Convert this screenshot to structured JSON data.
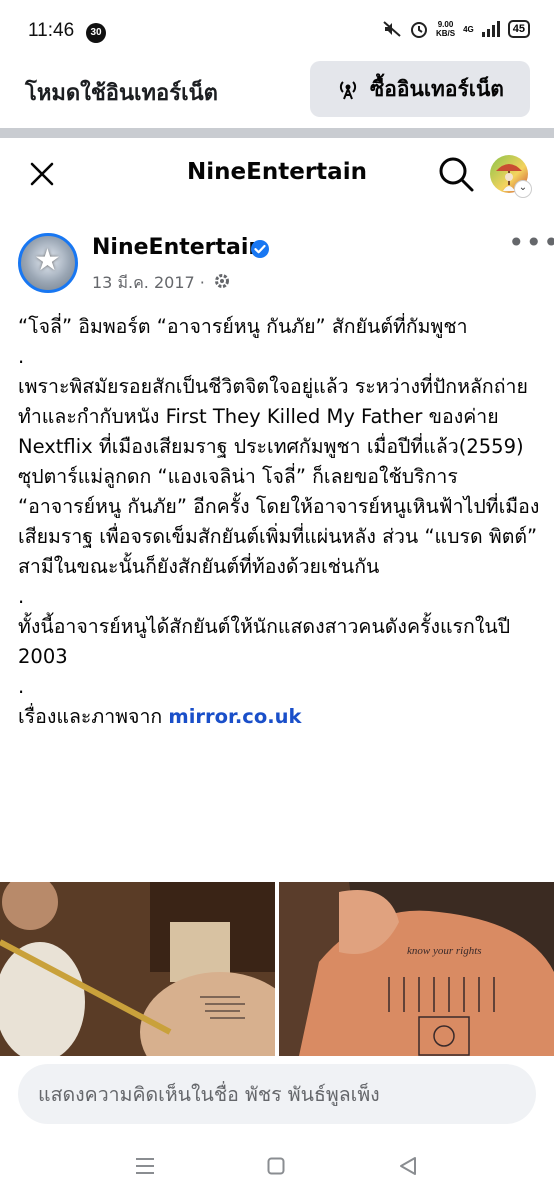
{
  "status_bar": {
    "time": "11:46",
    "notification_count": "30",
    "net_speed_top": "9.00",
    "net_speed_bottom": "KB/S",
    "network_type": "4G",
    "battery": "45"
  },
  "data_mode_bar": {
    "label": "โหมดใช้อินเทอร์เน็ต",
    "buy_button_label": "ซื้ออินเทอร์เน็ต"
  },
  "header": {
    "title": "NineEntertain"
  },
  "post": {
    "page_name": "NineEntertain",
    "date": "13 มี.ค. 2017 ·",
    "paragraphs": [
      "“โจลี่” อิมพอร์ต “อาจารย์หนู กันภัย” สักยันต์ที่กัมพูชา",
      ".",
      "เพราะพิสมัยรอยสักเป็นชีวิตจิตใจอยู่แล้ว ระหว่างที่ปักหลักถ่ายทำและกำกับหนัง First They Killed My Father ของค่าย Nextflix ที่เมืองเสียมราฐ ประเทศกัมพูชา เมื่อปีที่แล้ว(2559) ซุปตาร์แม่ลูกดก “แองเจลิน่า โจลี่” ก็เลยขอใช้บริการ “อาจารย์หนู กันภัย” อีกครั้ง โดยให้อาจารย์หนูเหินฟ้าไปที่เมืองเสียมราฐ เพื่อจรดเข็มสักยันต์เพิ่มที่แผ่นหลัง ส่วน “แบรด พิตต์” สามีในขณะนั้นก็ยังสักยันต์ที่ท้องด้วยเช่นกัน",
      ".",
      "ทั้งนี้อาจารย์หนูได้สักยันต์ให้นักแสดงสาวคนดังครั้งแรกในปี 2003",
      "."
    ],
    "source_prefix": "เรื่องและภาพจาก ",
    "source_link": "mirror.co.uk",
    "photo2_tattoo_text": "know your rights"
  },
  "comment": {
    "placeholder": "แสดงความคิดเห็นในชื่อ พัชร พันธ์พูลเพ็ง"
  },
  "colors": {
    "accent": "#1877f2",
    "link": "#1a4fc9",
    "secondary_text": "#65676b",
    "divider": "#c9ccd1",
    "button_bg": "#e4e6eb"
  }
}
